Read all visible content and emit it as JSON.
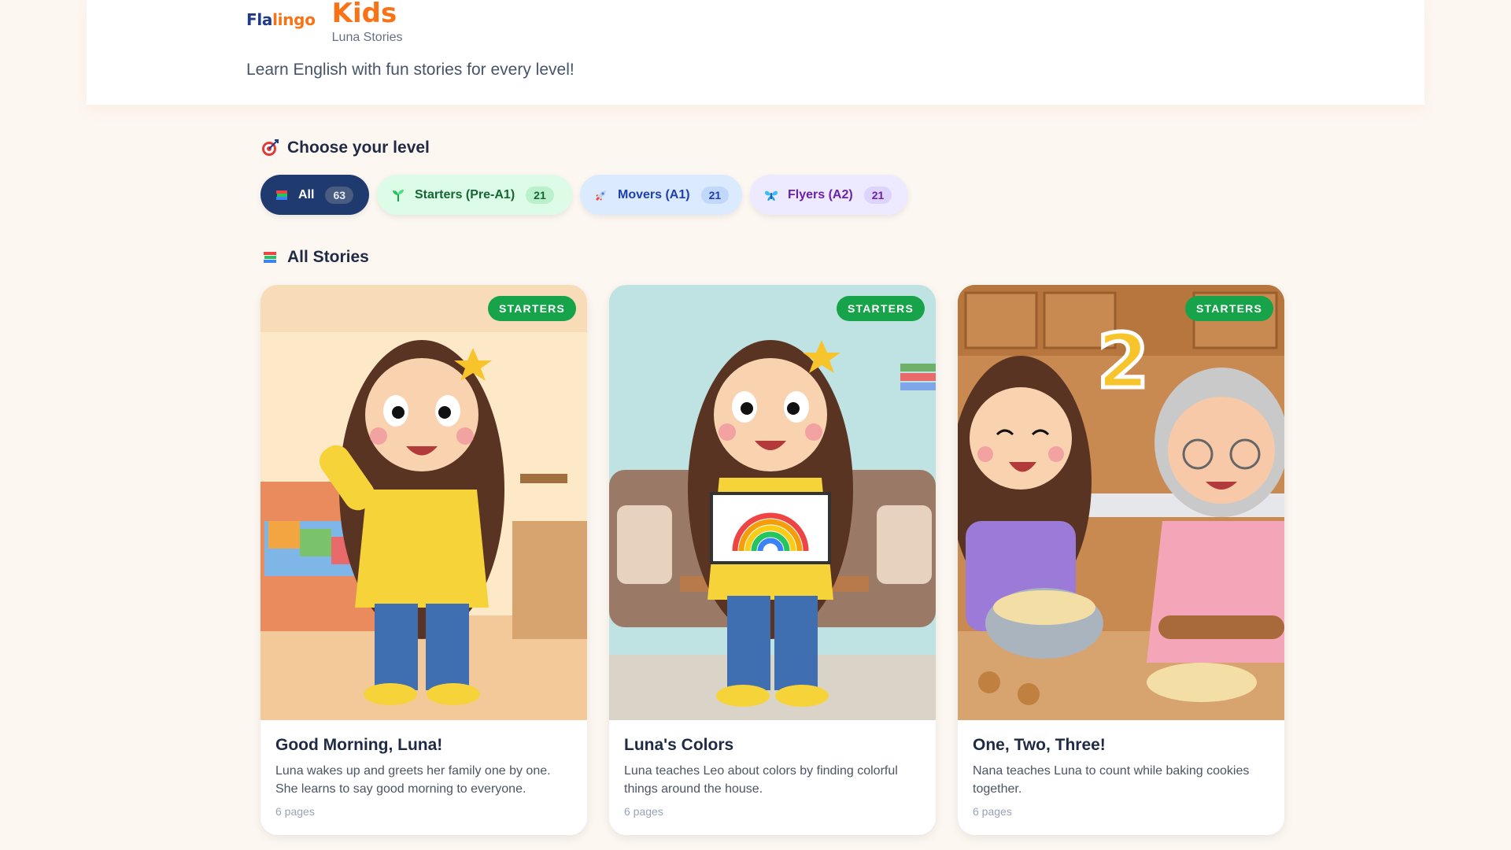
{
  "brand": {
    "logo_part1": "Fla",
    "logo_part2": "lingo",
    "name": "Kids",
    "subtitle": "Luna Stories"
  },
  "tagline": "Learn English with fun stories for every level!",
  "level_section": {
    "icon": "target-icon",
    "title": "Choose your level"
  },
  "filters": [
    {
      "icon": "books-icon",
      "label": "All",
      "count": "63",
      "active": true
    },
    {
      "icon": "seedling-icon",
      "label": "Starters (Pre-A1)",
      "count": "21"
    },
    {
      "icon": "rocket-icon",
      "label": "Movers (A1)",
      "count": "21"
    },
    {
      "icon": "butterfly-icon",
      "label": "Flyers (A2)",
      "count": "21"
    }
  ],
  "stories_section": {
    "icon": "books-icon",
    "title": "All Stories"
  },
  "stories": [
    {
      "badge": "STARTERS",
      "title": "Good Morning, Luna!",
      "description": "Luna wakes up and greets her family one by one. She learns to say good morning to everyone.",
      "pages": "6 pages",
      "illustration": "luna-waving-bedroom"
    },
    {
      "badge": "STARTERS",
      "title": "Luna's Colors",
      "description": "Luna teaches Leo about colors by finding colorful things around the house.",
      "pages": "6 pages",
      "illustration": "luna-holding-rainbow"
    },
    {
      "badge": "STARTERS",
      "title": "One, Two, Three!",
      "description": "Nana teaches Luna to count while baking cookies together.",
      "pages": "6 pages",
      "illustration": "luna-baking-with-nana"
    }
  ],
  "colors": {
    "accent": "#f97316",
    "navy": "#1e3a6e",
    "starters_badge": "#16a34a",
    "background": "#fdf7f1"
  }
}
